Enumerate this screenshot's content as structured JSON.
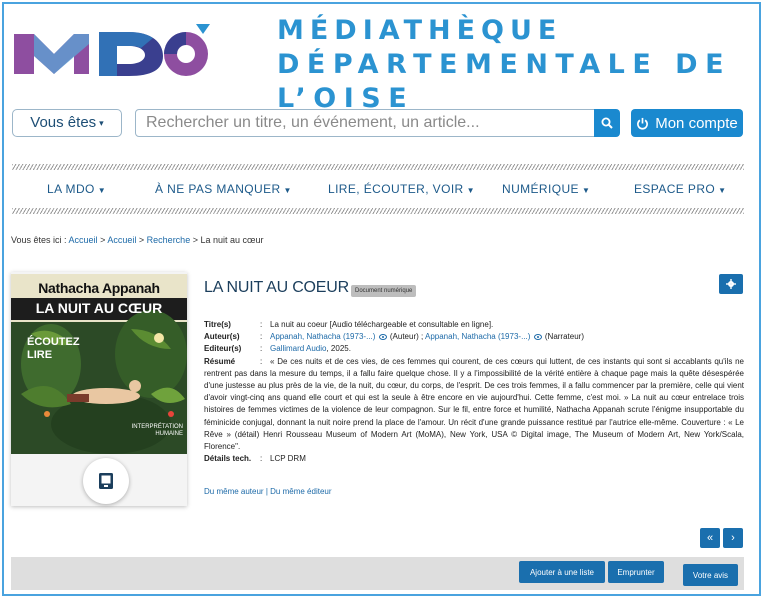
{
  "header": {
    "logo_text": "MDO",
    "title_line1": "MÉDIATHÈQUE",
    "title_line2": "DÉPARTEMENTALE DE L’OISE"
  },
  "search": {
    "you_are_label": "Vous êtes",
    "placeholder": "Rechercher un titre, un événement, un article...",
    "account_label": "Mon compte"
  },
  "nav": {
    "items": [
      {
        "label": "LA MDO"
      },
      {
        "label": "À NE PAS MANQUER"
      },
      {
        "label": "LIRE, ÉCOUTER, VOIR"
      },
      {
        "label": "NUMÉRIQUE"
      },
      {
        "label": "ESPACE PRO"
      }
    ]
  },
  "breadcrumb": {
    "prefix": "Vous êtes ici :",
    "items": [
      "Accueil",
      "Accueil",
      "Recherche",
      "La nuit au cœur"
    ],
    "separator": ">"
  },
  "cover": {
    "author": "Nathacha Appanah",
    "title": "LA NUIT AU CŒUR",
    "badge_line1": "ÉCOUTEZ",
    "badge_line2": "LIRE",
    "interp_line1": "INTERPRÉTATION",
    "interp_line2": "HUMAINE"
  },
  "record": {
    "title": "LA NUIT AU COEUR",
    "badge": "Document numérique",
    "fields": {
      "titre_label": "Titre(s)",
      "titre_value": "La nuit au coeur [Audio téléchargeable et consultable en ligne].",
      "auteur_label": "Auteur(s)",
      "auteur1": "Appanah, Nathacha (1973-...)",
      "role1": "(Auteur) ;",
      "auteur2": "Appanah, Nathacha (1973-...)",
      "role2": "(Narrateur)",
      "editeur_label": "Editeur(s)",
      "editeur_value": "Gallimard Audio",
      "editeur_year": ", 2025.",
      "resume_label": "Résumé",
      "resume_value": "« De ces nuits et de ces vies, de ces femmes qui courent, de ces cœurs qui luttent, de ces instants qui sont si accablants qu'ils ne rentrent pas dans la mesure du temps, il a fallu faire quelque chose. Il y a l'impossibilité de la vérité entière à chaque page mais la quête désespérée d'une justesse au plus près de la vie, de la nuit, du cœur, du corps, de l'esprit. De ces trois femmes, il a fallu commencer par la première, celle qui vient d'avoir vingt-cinq ans quand elle court et qui est la seule à être encore en vie aujourd'hui. Cette femme, c'est moi. » La nuit au cœur entrelace trois histoires de femmes victimes de la violence de leur compagnon. Sur le fil, entre force et humilité, Nathacha Appanah scrute l'énigme insupportable du féminicide conjugal, donnant la nuit noire prend la place de l'amour. Un récit d'une grande puissance restitué par l'autrice elle-même. Couverture : « Le Rêve » (détail) Henri Rousseau Museum of Modern Art (MoMA), New York, USA © Digital image, The Museum of Modern Art, New York/Scala, Florence\".",
      "details_label": "Détails tech.",
      "details_value": "LCP DRM"
    },
    "sep": ":",
    "same_author": "Du même auteur",
    "link_sep": "|",
    "same_publisher": "Du même éditeur"
  },
  "pager": {
    "prev": "«",
    "next": "›"
  },
  "actions": {
    "add_list": "Ajouter à une liste",
    "borrow": "Emprunter",
    "review": "Votre avis"
  },
  "colors": {
    "accent": "#1a89cf",
    "button_dark": "#1a6fae",
    "title_blue": "#2b93d1"
  }
}
